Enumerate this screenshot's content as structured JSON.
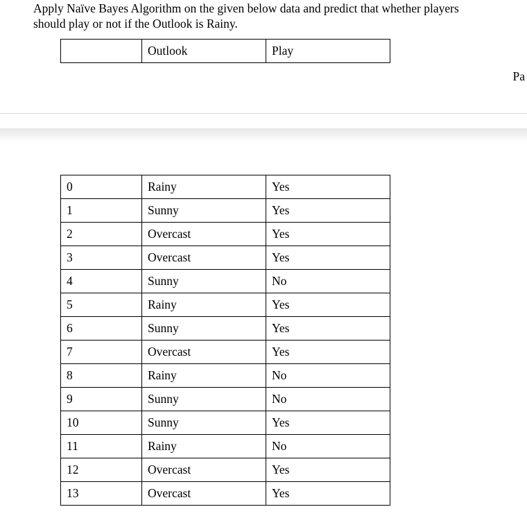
{
  "question_line1": "Apply Naïve Bayes Algorithm on the given below data and predict that whether players",
  "question_line2": "should play or not if the Outlook is Rainy.",
  "header": {
    "idx": "",
    "outlook": "Outlook",
    "play": "Play"
  },
  "page_fragment": "Pa",
  "chart_data": {
    "type": "table",
    "columns": [
      "",
      "Outlook",
      "Play"
    ],
    "rows": [
      {
        "idx": "0",
        "outlook": "Rainy",
        "play": "Yes"
      },
      {
        "idx": "1",
        "outlook": "Sunny",
        "play": "Yes"
      },
      {
        "idx": "2",
        "outlook": "Overcast",
        "play": "Yes"
      },
      {
        "idx": "3",
        "outlook": "Overcast",
        "play": "Yes"
      },
      {
        "idx": "4",
        "outlook": "Sunny",
        "play": "No"
      },
      {
        "idx": "5",
        "outlook": "Rainy",
        "play": "Yes"
      },
      {
        "idx": "6",
        "outlook": "Sunny",
        "play": "Yes"
      },
      {
        "idx": "7",
        "outlook": "Overcast",
        "play": "Yes"
      },
      {
        "idx": "8",
        "outlook": "Rainy",
        "play": "No"
      },
      {
        "idx": "9",
        "outlook": "Sunny",
        "play": "No"
      },
      {
        "idx": "10",
        "outlook": "Sunny",
        "play": "Yes"
      },
      {
        "idx": "11",
        "outlook": "Rainy",
        "play": "No"
      },
      {
        "idx": "12",
        "outlook": "Overcast",
        "play": "Yes"
      },
      {
        "idx": "13",
        "outlook": "Overcast",
        "play": "Yes"
      }
    ]
  }
}
